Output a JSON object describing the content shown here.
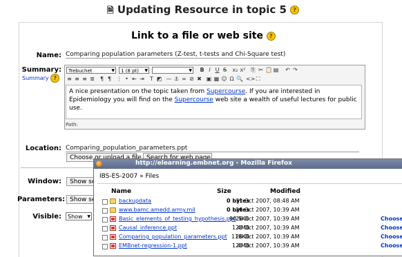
{
  "page": {
    "title": "Updating Resource in topic 5",
    "help_mark": "?"
  },
  "form": {
    "heading": "Link to a file or web site",
    "name_label": "Name:",
    "name_value": "Comparing population parameters (Z-test, t-tests and Chi-Square test)",
    "summary_label": "Summary:",
    "summary_link": "Summary",
    "location_label": "Location:",
    "location_value": "Comparing_population_parameters.ppt",
    "choose_upload_btn": "Choose or upload a file ...",
    "search_web_btn": "Search for web page ...",
    "window_label": "Window:",
    "window_btn": "Show set",
    "parameters_label": "Parameters:",
    "parameters_btn": "Show set",
    "visible_label": "Visible:",
    "visible_value": "Show"
  },
  "editor": {
    "font_family": "Trebuchet",
    "font_size": "1 (8 pt)",
    "style": "",
    "text_before_link1": "A nice presentation on the topic taken from ",
    "link1": "Supercourse",
    "text_middle": ". If you are interested in Epidemiology you will find on the ",
    "link2": "Supercourse",
    "text_after": " web site a wealth of useful lectures for public use.",
    "path_label": "Path:"
  },
  "popup": {
    "title": "http://elearning.embnet.org - Mozilla Firefox",
    "breadcrumb_course": "IBS-ES-2007",
    "breadcrumb_sep": "»",
    "breadcrumb_page": "Files",
    "columns": {
      "name": "Name",
      "size": "Size",
      "modified": "Modified"
    },
    "files": [
      {
        "type": "folder",
        "name": "backupdata",
        "size": "0 bytes",
        "modified": "31 Oct 2007, 08:48 AM",
        "choose": ""
      },
      {
        "type": "folder",
        "name": "www.bamc.amedd.army.mil",
        "size": "0 bytes",
        "modified": "26 Oct 2007, 10:39 AM",
        "choose": ""
      },
      {
        "type": "ppt",
        "name": "Basic_elements_of_testing_hypothesis.ppt",
        "size": "90.5KB",
        "modified": "26 Oct 2007, 10:39 AM",
        "choose": "Choose"
      },
      {
        "type": "ppt",
        "name": "Causal_inference.ppt",
        "size": "1.4MB",
        "modified": "26 Oct 2007, 10:39 AM",
        "choose": "Choose"
      },
      {
        "type": "ppt",
        "name": "Comparing_population_parameters.ppt",
        "size": "118KB",
        "modified": "26 Oct 2007, 10:39 AM",
        "choose": "Choose"
      },
      {
        "type": "ppt",
        "name": "EMBnet-regression-1.ppt",
        "size": "1.4MB",
        "modified": "26 Oct 2007, 10:39 AM",
        "choose": "Choose"
      }
    ]
  }
}
